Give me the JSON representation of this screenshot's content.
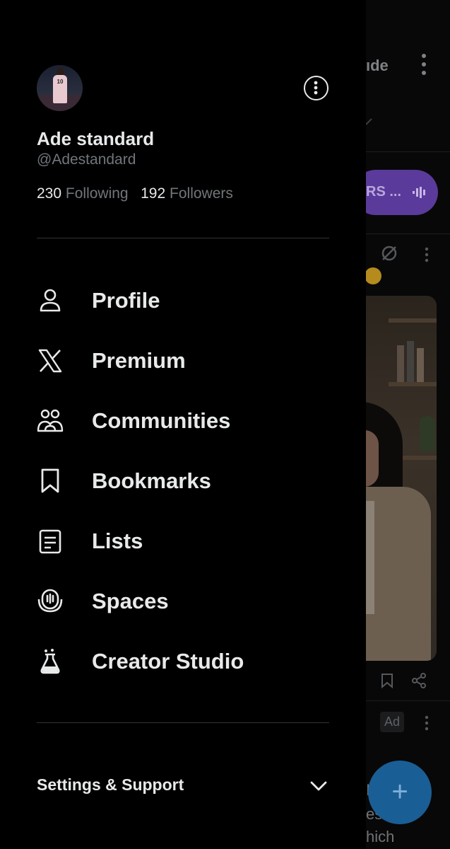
{
  "background": {
    "header_name_fragment": "ıde",
    "space_pill_text": "RS ...",
    "ad_badge": "Ad",
    "text_fragments": [
      "I",
      "es",
      "hich"
    ]
  },
  "profile": {
    "display_name": "Ade standard",
    "handle": "@Adestandard",
    "following_count": "230",
    "following_label": "Following",
    "followers_count": "192",
    "followers_label": "Followers",
    "avatar_jersey_number": "10"
  },
  "menu": {
    "items": [
      {
        "label": "Profile",
        "icon": "person-icon"
      },
      {
        "label": "Premium",
        "icon": "x-logo-icon"
      },
      {
        "label": "Communities",
        "icon": "communities-icon"
      },
      {
        "label": "Bookmarks",
        "icon": "bookmark-icon"
      },
      {
        "label": "Lists",
        "icon": "list-icon"
      },
      {
        "label": "Spaces",
        "icon": "spaces-icon"
      },
      {
        "label": "Creator Studio",
        "icon": "flask-icon"
      }
    ]
  },
  "settings": {
    "label": "Settings & Support"
  },
  "colors": {
    "background": "#000000",
    "primary_text": "#e7e9ea",
    "secondary_text": "#71767b",
    "divider": "#2f3336",
    "fab": "#1a5e96",
    "space_pill": "#5a3a9a"
  }
}
